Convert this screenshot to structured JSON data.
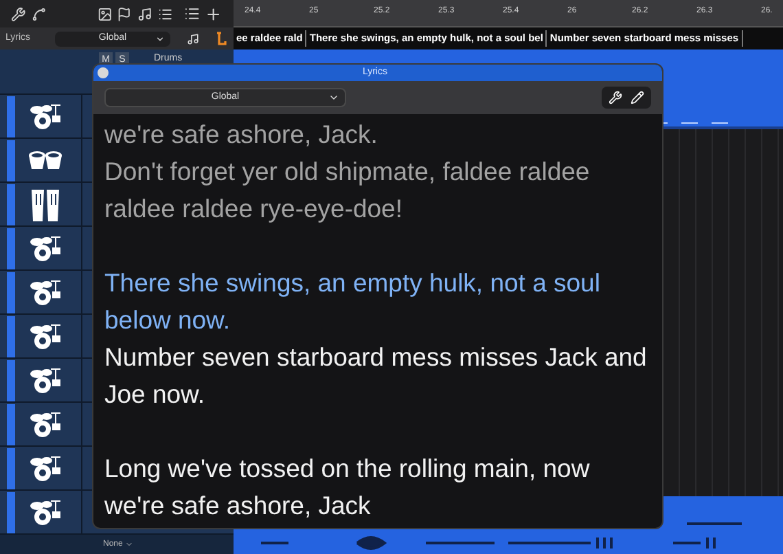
{
  "ruler": {
    "ticks": [
      "24.4",
      "25",
      "25.2",
      "25.3",
      "25.4",
      "26",
      "26.2",
      "26.3",
      "26."
    ]
  },
  "lyrics_lane": {
    "label": "Lyrics",
    "preset": "Global",
    "segments": [
      "ee raldee rald",
      "There she swings, an empty hulk, not a soul bel",
      "Number seven starboard mess misses"
    ]
  },
  "track_header": {
    "buttons": [
      "M",
      "S"
    ],
    "name": "Drums"
  },
  "tracks": [
    {
      "kind": "drumkit"
    },
    {
      "kind": "bongos"
    },
    {
      "kind": "congas"
    },
    {
      "kind": "drumkit"
    },
    {
      "kind": "drumkit"
    },
    {
      "kind": "drumkit"
    },
    {
      "kind": "drumkit"
    },
    {
      "kind": "drumkit"
    },
    {
      "kind": "drumkit"
    },
    {
      "kind": "drumkit"
    }
  ],
  "track_footer": {
    "preset": "None"
  },
  "lyrics_window": {
    "title": "Lyrics",
    "preset": "Global",
    "paragraphs": [
      [
        {
          "text": "we're safe ashore, Jack.",
          "kind": "sung"
        },
        {
          "text": "Don't forget yer old shipmate, faldee raldee raldee raldee rye-eye-doe!",
          "kind": "sung"
        }
      ],
      [
        {
          "text": "There she swings, an empty hulk, not a soul below now.",
          "kind": "current"
        },
        {
          "text": "Number seven starboard mess misses Jack and Joe now.",
          "kind": "unsung"
        }
      ],
      [
        {
          "text": "Long we've tossed on the rolling main, now we're safe ashore, Jack",
          "kind": "unsung"
        }
      ]
    ]
  }
}
